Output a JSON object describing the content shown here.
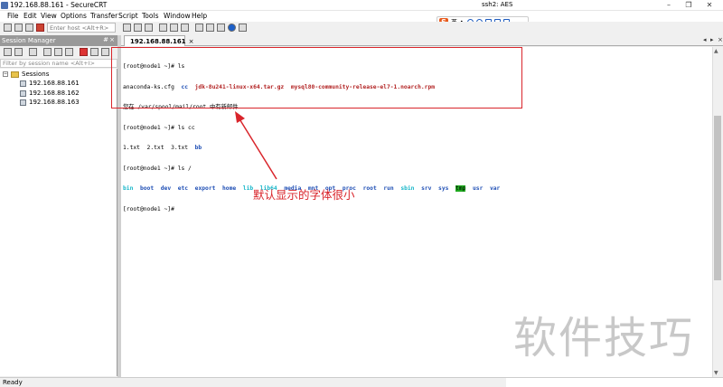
{
  "window": {
    "title": "192.168.88.161 - SecureCRT"
  },
  "menu": [
    "File",
    "Edit",
    "View",
    "Options",
    "Transfer",
    "Script",
    "Tools",
    "Window",
    "Help"
  ],
  "ime": {
    "label": "英"
  },
  "toolbar": {
    "host_placeholder": "Enter host <Alt+R>"
  },
  "session_manager": {
    "title": "Session Manager",
    "pin": "#",
    "close": "×",
    "filter_placeholder": "Filter by session name <Alt+I>",
    "root": "Sessions",
    "sessions": [
      "192.168.88.161",
      "192.168.88.162",
      "192.168.88.163"
    ]
  },
  "tab": {
    "label": "192.168.88.161",
    "close": "×"
  },
  "terminal": {
    "l1": "[root@node1 ~]# ls",
    "l2_a": "anaconda-ks.cfg  ",
    "l2_b": "cc",
    "l2_c": "  ",
    "l2_d": "jdk-8u241-linux-x64.tar.gz",
    "l2_e": "  ",
    "l2_f": "mysql80-community-release-el7-1.noarch.rpm",
    "l3": "您在 /var/spool/mail/root 中有新邮件",
    "l4": "[root@node1 ~]# ls cc",
    "l5_a": "1.txt  2.txt  3.txt  ",
    "l5_b": "bb",
    "l6": "[root@node1 ~]# ls /",
    "root_dirs": [
      {
        "name": "bin",
        "kind": "sym"
      },
      {
        "name": "boot",
        "kind": "dir"
      },
      {
        "name": "dev",
        "kind": "dir"
      },
      {
        "name": "etc",
        "kind": "dir"
      },
      {
        "name": "export",
        "kind": "dir"
      },
      {
        "name": "home",
        "kind": "dir"
      },
      {
        "name": "lib",
        "kind": "sym"
      },
      {
        "name": "lib64",
        "kind": "sym"
      },
      {
        "name": "media",
        "kind": "dir"
      },
      {
        "name": "mnt",
        "kind": "dir"
      },
      {
        "name": "opt",
        "kind": "dir"
      },
      {
        "name": "proc",
        "kind": "dir"
      },
      {
        "name": "root",
        "kind": "dir"
      },
      {
        "name": "run",
        "kind": "dir"
      },
      {
        "name": "sbin",
        "kind": "sym"
      },
      {
        "name": "srv",
        "kind": "dir"
      },
      {
        "name": "sys",
        "kind": "dir"
      },
      {
        "name": "tmp",
        "kind": "tmp"
      },
      {
        "name": "usr",
        "kind": "dir"
      },
      {
        "name": "var",
        "kind": "dir"
      }
    ],
    "l8": "[root@node1 ~]#"
  },
  "annotation": {
    "text": "默认显示的字体很小",
    "color": "#d9252b"
  },
  "watermark": "软件技巧",
  "status": {
    "left": "Ready",
    "right": "ssh2: AES"
  }
}
